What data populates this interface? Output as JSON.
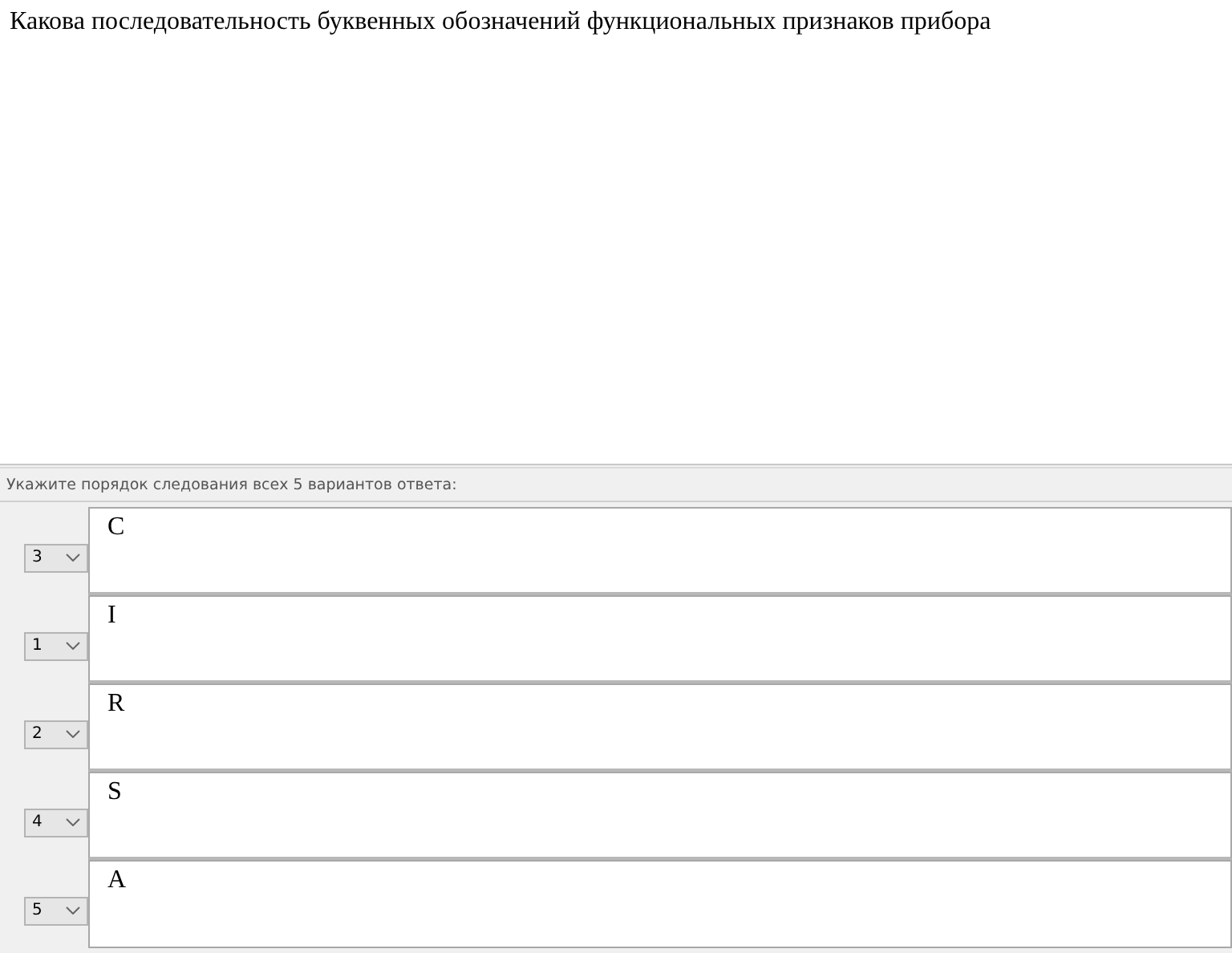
{
  "question": "Какова последовательность буквенных обозначений функциональных признаков прибора",
  "instruction": "Укажите порядок следования всех 5 вариантов ответа:",
  "answers": [
    {
      "order": "3",
      "text": "C"
    },
    {
      "order": "1",
      "text": "I"
    },
    {
      "order": "2",
      "text": "R"
    },
    {
      "order": "4",
      "text": "S"
    },
    {
      "order": "5",
      "text": "A"
    }
  ]
}
